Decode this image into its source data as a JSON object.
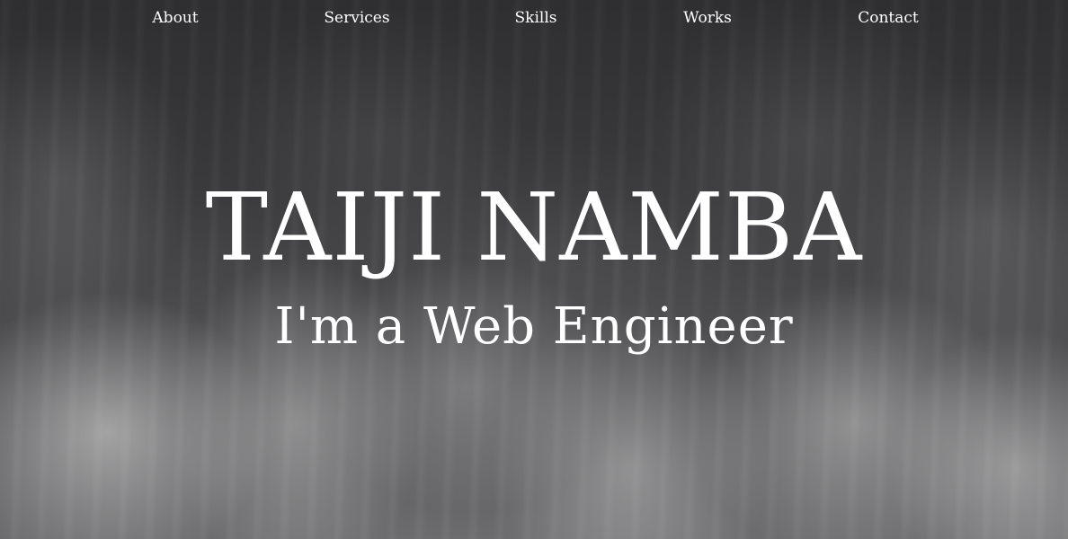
{
  "nav": {
    "items": [
      {
        "label": "About"
      },
      {
        "label": "Services"
      },
      {
        "label": "Skills"
      },
      {
        "label": "Works"
      },
      {
        "label": "Contact"
      }
    ]
  },
  "hero": {
    "title": "TAIJI NAMBA",
    "subtitle": "I'm a Web Engineer",
    "background_description_color": "#3a3a3d",
    "text_color": "#ffffff"
  }
}
